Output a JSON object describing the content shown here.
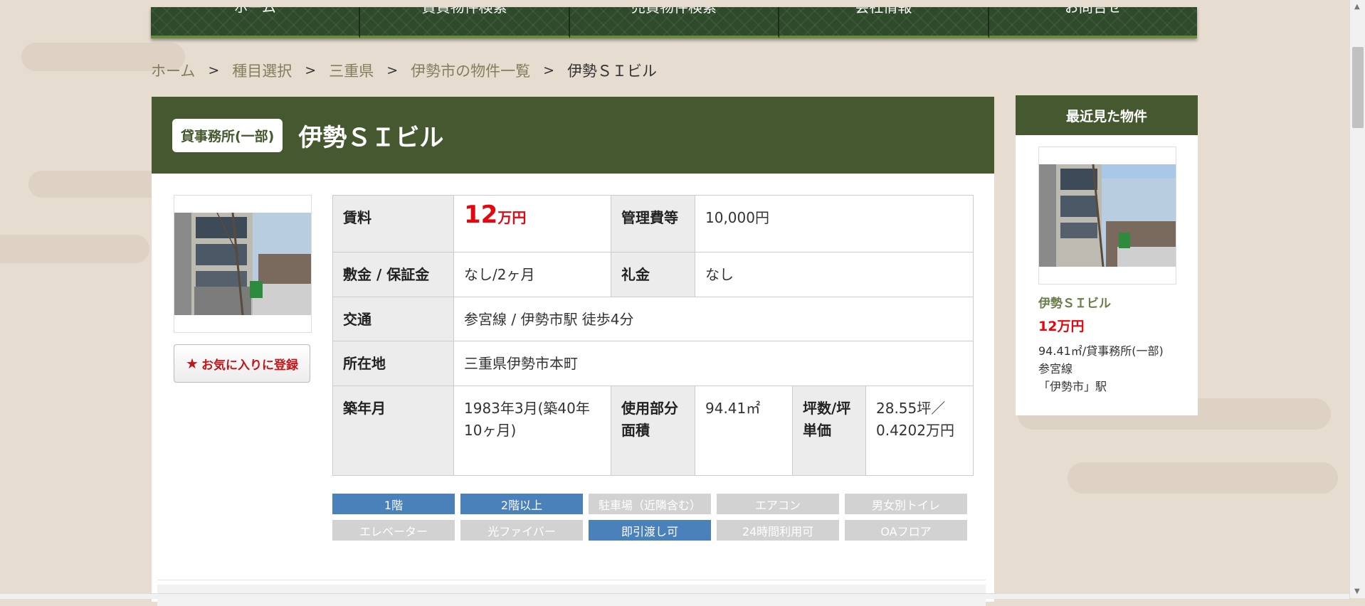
{
  "nav": {
    "items": [
      "ホーム",
      "賃貸物件検索",
      "売買物件検索",
      "会社情報",
      "お問合せ"
    ]
  },
  "breadcrumb": {
    "items": [
      "ホーム",
      "種目選択",
      "三重県",
      "伊勢市の物件一覧"
    ],
    "current": "伊勢ＳＩビル",
    "separator": ">"
  },
  "property": {
    "type_badge": "貸事務所(一部)",
    "name": "伊勢ＳＩビル",
    "photo_icon": "building-photo",
    "favorite_label": "お気に入りに登録",
    "favorite_icon": "★"
  },
  "spec": {
    "rent_label": "賃料",
    "rent_value": "12",
    "rent_unit": "万円",
    "mgmt_label": "管理費等",
    "mgmt_value": "10,000円",
    "deposit_label": "敷金 / 保証金",
    "deposit_value": "なし/2ヶ月",
    "key_money_label": "礼金",
    "key_money_value": "なし",
    "access_label": "交通",
    "access_value": "参宮線 / 伊勢市駅 徒歩4分",
    "address_label": "所在地",
    "address_value": "三重県伊勢市本町",
    "built_label": "築年月",
    "built_value": "1983年3月(築40年10ヶ月)",
    "area_label": "使用部分面積",
    "area_value": "94.41㎡",
    "tsubo_label": "坪数/坪単価",
    "tsubo_value": "28.55坪／0.4202万円"
  },
  "tags": [
    {
      "label": "1階",
      "active": true
    },
    {
      "label": "2階以上",
      "active": true
    },
    {
      "label": "駐車場（近隣含む）",
      "active": false
    },
    {
      "label": "エアコン",
      "active": false
    },
    {
      "label": "男女別トイレ",
      "active": false
    },
    {
      "label": "エレベーター",
      "active": false
    },
    {
      "label": "光ファイバー",
      "active": false
    },
    {
      "label": "即引渡し可",
      "active": true
    },
    {
      "label": "24時間利用可",
      "active": false
    },
    {
      "label": "OAフロア",
      "active": false
    }
  ],
  "recent": {
    "heading": "最近見た物件",
    "name": "伊勢ＳＩビル",
    "price": "12万円",
    "info_line1": "94.41㎡/貸事務所(一部)",
    "info_line2": "参宮線",
    "info_line3": "「伊勢市」駅"
  },
  "colors": {
    "header_green": "#45582f",
    "nav_green": "#2f4a2b",
    "price_red": "#e5070f",
    "tag_active": "#4a81bb",
    "tag_inactive": "#d2d2d2",
    "breadcrumb_link": "#857e5d"
  }
}
